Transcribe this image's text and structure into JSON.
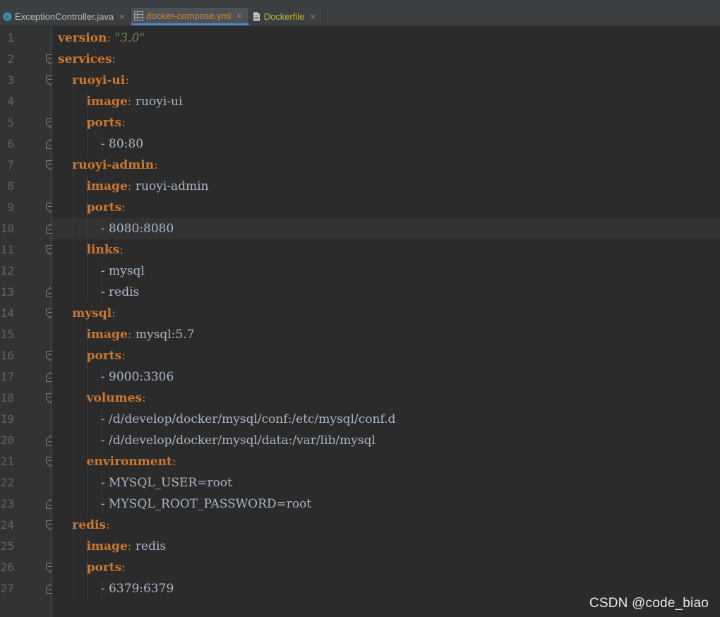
{
  "tabs": [
    {
      "label": "ExceptionController.java",
      "icon": "java-class-icon",
      "active": false,
      "color": "#bbbbbb"
    },
    {
      "label": "docker-compose.yml",
      "icon": "yaml-file-icon",
      "active": true,
      "color": "#d0823a"
    },
    {
      "label": "Dockerfile",
      "icon": "dockerfile-icon",
      "active": false,
      "color": "#c0b73c"
    }
  ],
  "tab_close_glyph": "×",
  "editor": {
    "current_line": 10,
    "lines": [
      {
        "n": "1",
        "indent": 0,
        "key": "version",
        "colon": ":",
        "value": "\"3.0\"",
        "value_type": "string",
        "fold": ""
      },
      {
        "n": "2",
        "indent": 0,
        "key": "services",
        "colon": ":",
        "value": "",
        "value_type": "plain",
        "fold": "open"
      },
      {
        "n": "3",
        "indent": 1,
        "key": "ruoyi-ui",
        "colon": ":",
        "value": "",
        "value_type": "plain",
        "fold": "open"
      },
      {
        "n": "4",
        "indent": 2,
        "key": "image",
        "colon": ":",
        "value": "ruoyi-ui",
        "value_type": "plain",
        "fold": ""
      },
      {
        "n": "5",
        "indent": 2,
        "key": "ports",
        "colon": ":",
        "value": "",
        "value_type": "plain",
        "fold": "open"
      },
      {
        "n": "6",
        "indent": 3,
        "dash": "-",
        "value": "80:80",
        "value_type": "plain",
        "fold": "close"
      },
      {
        "n": "7",
        "indent": 1,
        "key": "ruoyi-admin",
        "colon": ":",
        "value": "",
        "value_type": "plain",
        "fold": "open"
      },
      {
        "n": "8",
        "indent": 2,
        "key": "image",
        "colon": ":",
        "value": "ruoyi-admin",
        "value_type": "plain",
        "fold": ""
      },
      {
        "n": "9",
        "indent": 2,
        "key": "ports",
        "colon": ":",
        "value": "",
        "value_type": "plain",
        "fold": "open"
      },
      {
        "n": "10",
        "indent": 3,
        "dash": "-",
        "value": "8080:8080",
        "value_type": "plain",
        "fold": "close"
      },
      {
        "n": "11",
        "indent": 2,
        "key": "links",
        "colon": ":",
        "value": "",
        "value_type": "plain",
        "fold": "open"
      },
      {
        "n": "12",
        "indent": 3,
        "dash": "-",
        "value": "mysql",
        "value_type": "plain",
        "fold": ""
      },
      {
        "n": "13",
        "indent": 3,
        "dash": "-",
        "value": "redis",
        "value_type": "plain",
        "fold": "close"
      },
      {
        "n": "14",
        "indent": 1,
        "key": "mysql",
        "colon": ":",
        "value": "",
        "value_type": "plain",
        "fold": "open"
      },
      {
        "n": "15",
        "indent": 2,
        "key": "image",
        "colon": ":",
        "value": "mysql:5.7",
        "value_type": "plain",
        "fold": ""
      },
      {
        "n": "16",
        "indent": 2,
        "key": "ports",
        "colon": ":",
        "value": "",
        "value_type": "plain",
        "fold": "open"
      },
      {
        "n": "17",
        "indent": 3,
        "dash": "-",
        "value": "9000:3306",
        "value_type": "plain",
        "fold": "close"
      },
      {
        "n": "18",
        "indent": 2,
        "key": "volumes",
        "colon": ":",
        "value": "",
        "value_type": "plain",
        "fold": "open"
      },
      {
        "n": "19",
        "indent": 3,
        "dash": "-",
        "value": "/d/develop/docker/mysql/conf:/etc/mysql/conf.d",
        "value_type": "plain",
        "fold": ""
      },
      {
        "n": "20",
        "indent": 3,
        "dash": "-",
        "value": "/d/develop/docker/mysql/data:/var/lib/mysql",
        "value_type": "plain",
        "fold": "close"
      },
      {
        "n": "21",
        "indent": 2,
        "key": "environment",
        "colon": ":",
        "value": "",
        "value_type": "plain",
        "fold": "open"
      },
      {
        "n": "22",
        "indent": 3,
        "dash": "-",
        "value": "MYSQL_USER=root",
        "value_type": "plain",
        "fold": ""
      },
      {
        "n": "23",
        "indent": 3,
        "dash": "-",
        "value": "MYSQL_ROOT_PASSWORD=root",
        "value_type": "plain",
        "fold": "close"
      },
      {
        "n": "24",
        "indent": 1,
        "key": "redis",
        "colon": ":",
        "value": "",
        "value_type": "plain",
        "fold": "open"
      },
      {
        "n": "25",
        "indent": 2,
        "key": "image",
        "colon": ":",
        "value": "redis",
        "value_type": "plain",
        "fold": ""
      },
      {
        "n": "26",
        "indent": 2,
        "key": "ports",
        "colon": ":",
        "value": "",
        "value_type": "plain",
        "fold": "open"
      },
      {
        "n": "27",
        "indent": 3,
        "dash": "-",
        "value": "6379:6379",
        "value_type": "plain",
        "fold": "close"
      }
    ]
  },
  "watermark": "CSDN @code_biao",
  "colors": {
    "background": "#2b2b2b",
    "gutter": "#313335",
    "key": "#cc7832",
    "string": "#6a8759",
    "text": "#a9b7c6",
    "line_number": "#606366",
    "active_tab_underline": "#4a88c7"
  }
}
